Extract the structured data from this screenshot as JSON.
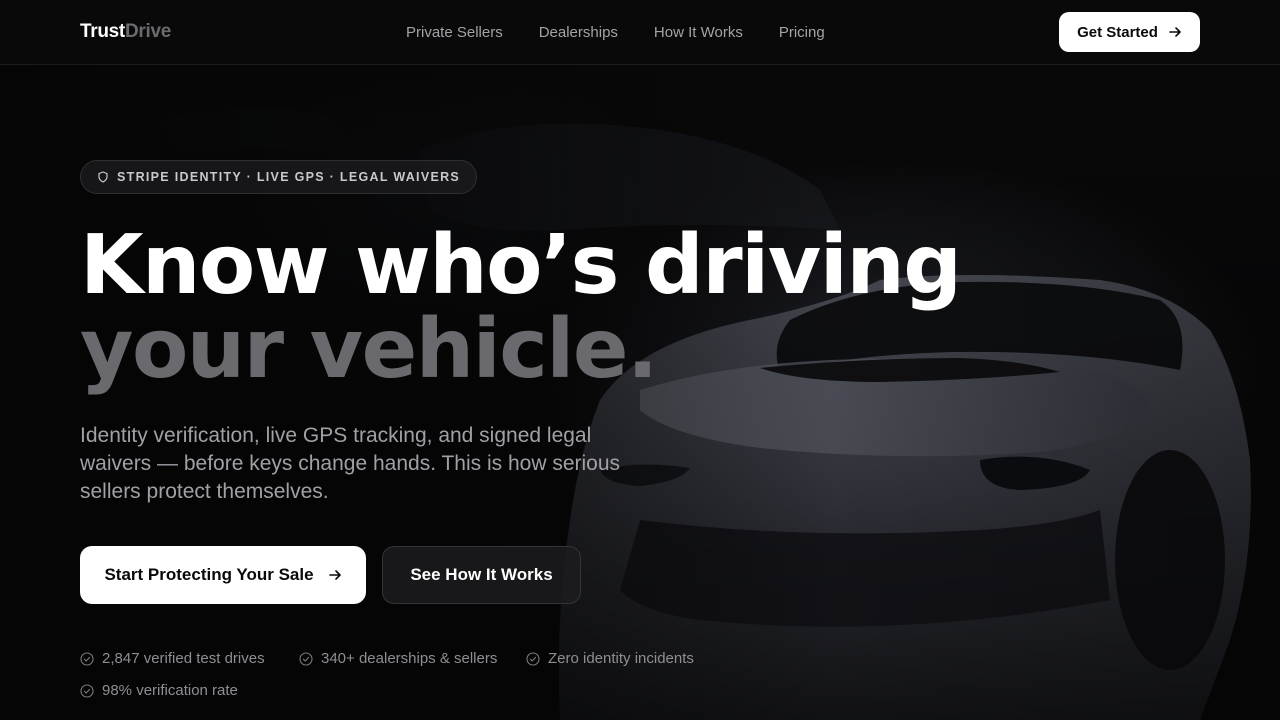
{
  "brand": {
    "part1": "Trust",
    "part2": "Drive"
  },
  "nav": {
    "links": [
      "Private Sellers",
      "Dealerships",
      "How It Works",
      "Pricing"
    ],
    "cta_label": "Get Started"
  },
  "hero": {
    "badge": "STRIPE IDENTITY · LIVE GPS · LEGAL WAIVERS",
    "headline_line1": "Know who’s driving",
    "headline_line2": "your vehicle.",
    "subtext": "Identity verification, live GPS tracking, and signed legal waivers — before keys change hands. This is how serious sellers protect themselves.",
    "primary_cta": "Start Protecting Your Sale",
    "secondary_cta": "See How It Works"
  },
  "stats": [
    "2,847 verified test drives",
    "340+ dealerships & sellers",
    "Zero identity incidents",
    "98% verification rate"
  ],
  "icons": {
    "badge": "shield-icon",
    "arrow": "arrow-right-icon",
    "stat": "check-circle-icon"
  },
  "colors": {
    "background": "#050505",
    "accent": "#ffffff",
    "muted": "#6a6a6e"
  }
}
